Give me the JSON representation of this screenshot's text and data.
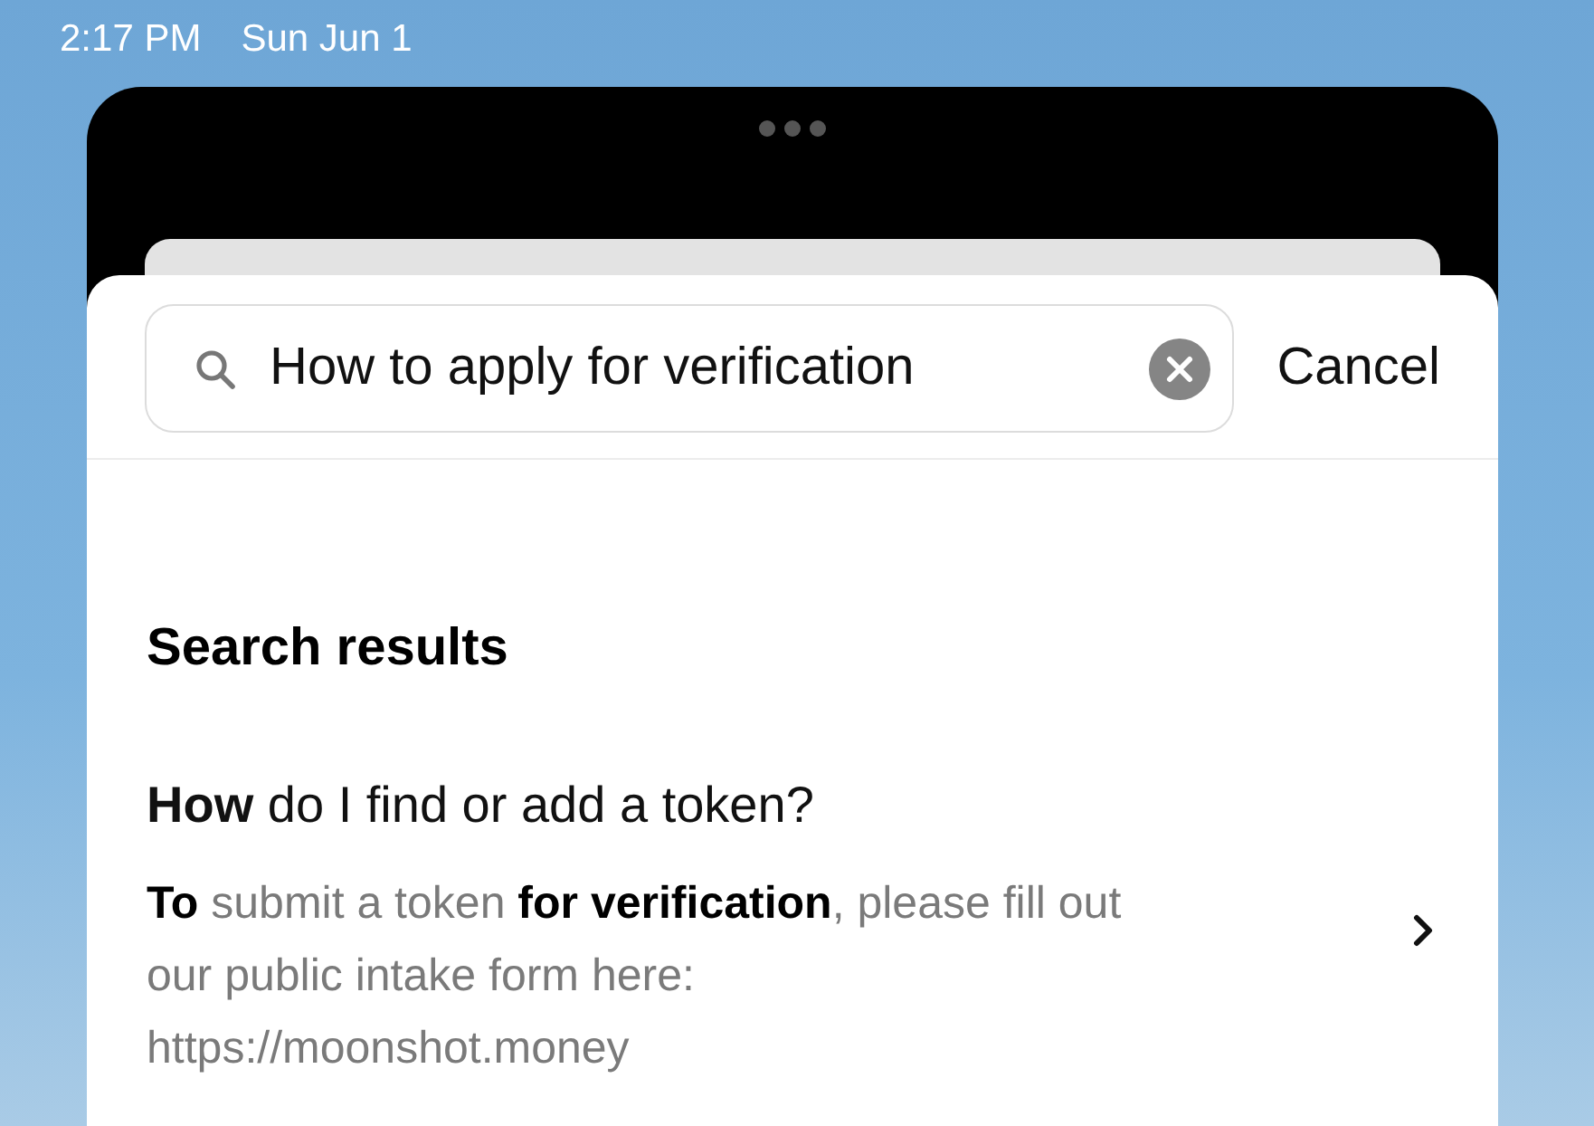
{
  "status_bar": {
    "time": "2:17 PM",
    "date": "Sun Jun 1"
  },
  "search": {
    "value": "How to apply for verification",
    "cancel": "Cancel"
  },
  "section_title": "Search results",
  "results": [
    {
      "title": "**How** do I find or add a token?",
      "snippet": "**To** submit a token **for verification**, please fill out our public intake form here: https://moonshot.money"
    }
  ]
}
